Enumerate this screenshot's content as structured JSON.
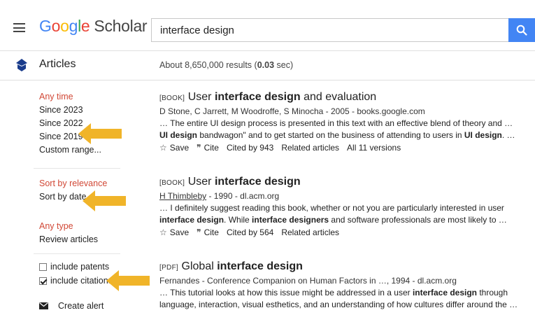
{
  "header": {
    "logo_letters": [
      "G",
      "o",
      "o",
      "g",
      "l",
      "e"
    ],
    "logo_suffix": "Scholar",
    "search_value": "interface design"
  },
  "subbar": {
    "section": "Articles",
    "stats_prefix": "About 8,650,000 results (",
    "stats_time": "0.03",
    "stats_suffix": " sec)"
  },
  "sidebar": {
    "time_filters": [
      "Any time",
      "Since 2023",
      "Since 2022",
      "Since 2019",
      "Custom range..."
    ],
    "sort_options": [
      "Sort by relevance",
      "Sort by date"
    ],
    "type_filters": [
      "Any type",
      "Review articles"
    ],
    "checkboxes": [
      {
        "label": "include patents",
        "checked": false
      },
      {
        "label": "include citations",
        "checked": true
      }
    ],
    "create_alert": "Create alert"
  },
  "results": [
    {
      "tag": "[BOOK]",
      "title_pre": "User ",
      "title_bold": "interface design",
      "title_post": " and evaluation",
      "meta": "D Stone, C Jarrett, M Woodroffe, S Minocha - 2005 - books.google.com",
      "snippet1": "… The entire UI design process is presented in this text with an effective blend of theory and …",
      "snippet2_bold": "UI design",
      "snippet2_a": " bandwagon\" and to get started on the business of attending to users in ",
      "snippet2_bold2": "UI design",
      "snippet2_b": ". …",
      "save": "Save",
      "cite": "Cite",
      "cited_by": "Cited by 943",
      "related": "Related articles",
      "versions": "All 11 versions"
    },
    {
      "tag": "[BOOK]",
      "title_pre": "User ",
      "title_bold": "interface design",
      "title_post": "",
      "meta_author": "H Thimbleby",
      "meta": " - 1990 - dl.acm.org",
      "snippet1": "… I definitely suggest reading this book, whether or not you are particularly interested in user",
      "snippet2_bold": "interface design",
      "snippet2_a": ". While ",
      "snippet2_bold2": "interface designers",
      "snippet2_b": " and software professionals are most likely to …",
      "save": "Save",
      "cite": "Cite",
      "cited_by": "Cited by 564",
      "related": "Related articles"
    },
    {
      "tag": "[PDF]",
      "title_pre": "Global ",
      "title_bold": "interface design",
      "title_post": "",
      "meta": "Fernandes - Conference Companion on Human Factors in …, 1994 - dl.acm.org",
      "snippet1_a": "… This tutorial looks at how this issue might be addressed in a user ",
      "snippet1_bold": "interface design",
      "snippet1_b": " through",
      "snippet2": "language, interaction, visual esthetics, and an understanding of how cultures differ around the …"
    }
  ],
  "colors": {
    "accent": "#4285f4",
    "selected_filter": "#d14836",
    "arrow": "#f0b429"
  }
}
